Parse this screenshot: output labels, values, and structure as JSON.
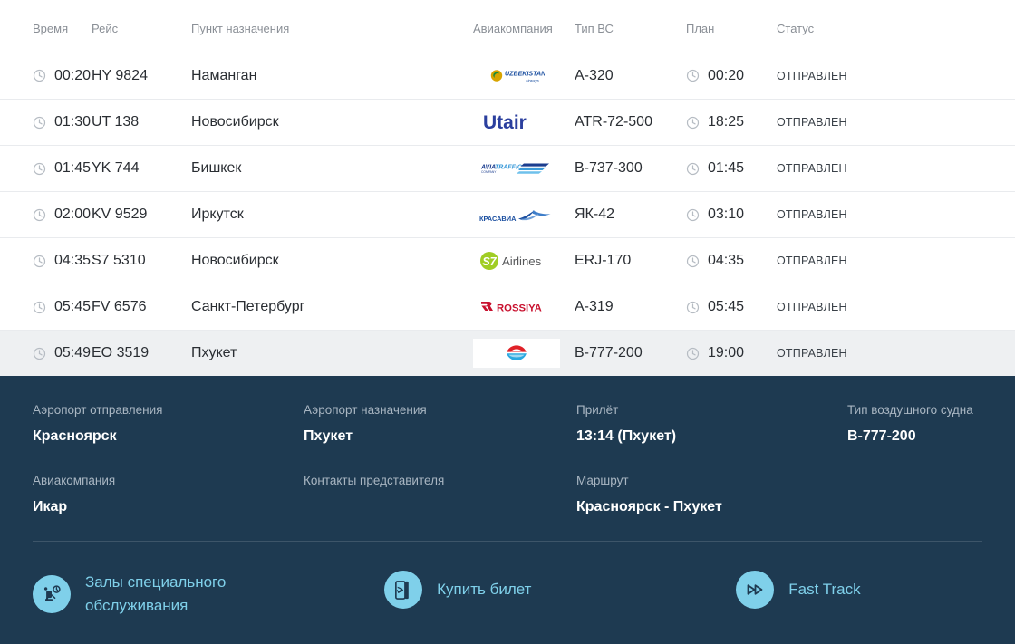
{
  "table": {
    "columns": [
      {
        "key": "time",
        "label": "Время"
      },
      {
        "key": "flight",
        "label": "Рейс"
      },
      {
        "key": "dest",
        "label": "Пункт назначения"
      },
      {
        "key": "airline",
        "label": "Авиакомпания"
      },
      {
        "key": "type",
        "label": "Тип ВС"
      },
      {
        "key": "plan",
        "label": "План"
      },
      {
        "key": "status",
        "label": "Статус"
      }
    ],
    "rows": [
      {
        "time": "00:20",
        "flight": "HY 9824",
        "dest": "Наманган",
        "airline_logo": "uzbekistan-airways-logo",
        "type": "А-320",
        "plan": "00:20",
        "status": "ОТПРАВЛЕН",
        "selected": false
      },
      {
        "time": "01:30",
        "flight": "UT 138",
        "dest": "Новосибирск",
        "airline_logo": "utair-logo",
        "type": "ATR-72-500",
        "plan": "18:25",
        "status": "ОТПРАВЛЕН",
        "selected": false
      },
      {
        "time": "01:45",
        "flight": "YK 744",
        "dest": "Бишкек",
        "airline_logo": "aviatraffic-logo",
        "type": "B-737-300",
        "plan": "01:45",
        "status": "ОТПРАВЛЕН",
        "selected": false
      },
      {
        "time": "02:00",
        "flight": "KV 9529",
        "dest": "Иркутск",
        "airline_logo": "krasavia-logo",
        "type": "ЯК-42",
        "plan": "03:10",
        "status": "ОТПРАВЛЕН",
        "selected": false
      },
      {
        "time": "04:35",
        "flight": "S7 5310",
        "dest": "Новосибирск",
        "airline_logo": "s7-airlines-logo",
        "type": "ERJ-170",
        "plan": "04:35",
        "status": "ОТПРАВЛЕН",
        "selected": false
      },
      {
        "time": "05:45",
        "flight": "FV 6576",
        "dest": "Санкт-Петербург",
        "airline_logo": "rossiya-logo",
        "type": "A-319",
        "plan": "05:45",
        "status": "ОТПРАВЛЕН",
        "selected": false
      },
      {
        "time": "05:49",
        "flight": "EO 3519",
        "dest": "Пхукет",
        "airline_logo": "ikar-logo",
        "type": "B-777-200",
        "plan": "19:00",
        "status": "ОТПРАВЛЕН",
        "selected": true
      }
    ]
  },
  "detail": {
    "fields": [
      {
        "label": "Аэропорт отправления",
        "value": "Красноярск"
      },
      {
        "label": "Аэропорт назначения",
        "value": "Пхукет"
      },
      {
        "label": "Прилёт",
        "value": "13:14 (Пхукет)"
      },
      {
        "label": "Тип воздушного судна",
        "value": "B-777-200"
      },
      {
        "label": "Авиакомпания",
        "value": "Икар"
      },
      {
        "label": "Контакты представителя",
        "value": ""
      },
      {
        "label": "Маршрут",
        "value": "Красноярск - Пхукет"
      },
      {
        "label": "",
        "value": ""
      }
    ]
  },
  "links": [
    {
      "label": "Залы специального обслуживания",
      "icon": "lounge-seat-clock-icon"
    },
    {
      "label": "Купить билет",
      "icon": "boarding-pass-plane-icon"
    },
    {
      "label": "Fast Track",
      "icon": "fast-forward-icon"
    }
  ],
  "colors": {
    "panel_bg": "#1e3a51",
    "accent": "#7fd0ea",
    "row_selected_bg": "#eef0f2",
    "header_text": "#8a8f96",
    "body_text": "#2a2e33",
    "border": "#e9ebee"
  }
}
